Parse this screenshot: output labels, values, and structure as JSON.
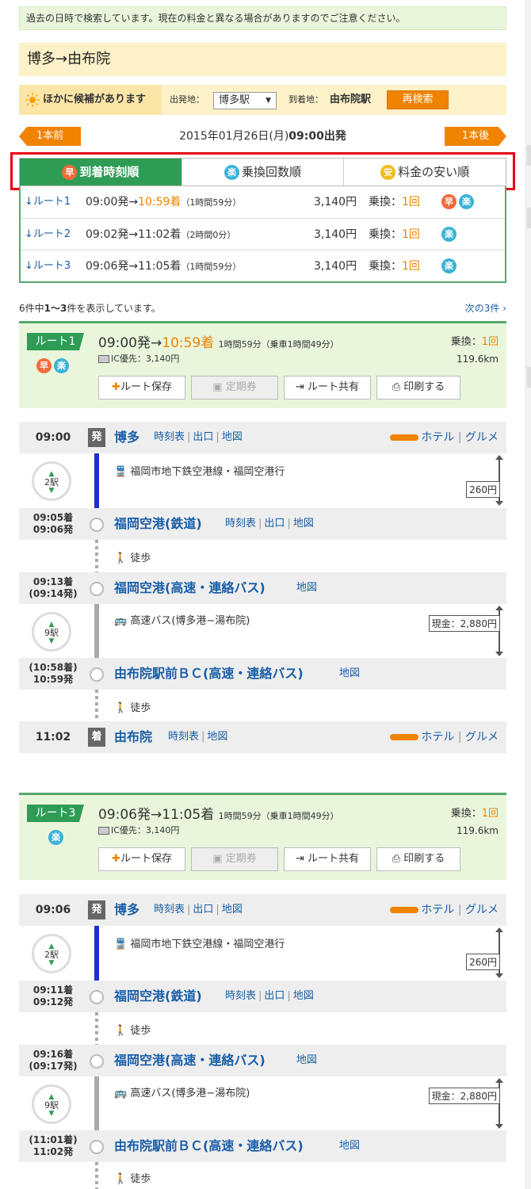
{
  "notice": "過去の日時で検索しています。現在の料金と異なる場合がありますのでご注意ください。",
  "title": "博多→由布院",
  "candidate": {
    "label": "ほかに候補があります",
    "from_label": "出発地：",
    "from_value": "博多駅",
    "to_label": "到着地：",
    "to_value": "由布院駅",
    "research": "再検索"
  },
  "nav": {
    "prev": "1本前",
    "next": "1本後",
    "date": "2015年01月26日(月)",
    "time": "09:00出発"
  },
  "tabs": [
    {
      "icon": "早",
      "label": "到着時刻順"
    },
    {
      "icon": "楽",
      "label": "乗換回数順"
    },
    {
      "icon": "安",
      "label": "料金の安い順"
    }
  ],
  "summary": [
    {
      "route": "↓ルート1",
      "dep": "09:00発→",
      "arr": "10:59着",
      "dur": "（1時間59分）",
      "price": "3,140円",
      "tr_label": "乗換：",
      "tr": "1回",
      "icons": [
        "早",
        "楽"
      ]
    },
    {
      "route": "↓ルート2",
      "dep": "09:02発→",
      "arr": "11:02着",
      "dur": "（2時間0分）",
      "price": "3,140円",
      "tr_label": "乗換：",
      "tr": "1回",
      "icons": [
        "楽"
      ]
    },
    {
      "route": "↓ルート3",
      "dep": "09:06発→",
      "arr": "11:05着",
      "dur": "（1時間59分）",
      "price": "3,140円",
      "tr_label": "乗換：",
      "tr": "1回",
      "icons": [
        "楽"
      ]
    }
  ],
  "count": {
    "pre": "6件中",
    "range": "1〜3",
    "post": "件を表示しています。",
    "next": "次の3件"
  },
  "route_buttons": {
    "save": "ルート保存",
    "pass": "定期券",
    "share": "ルート共有",
    "print": "印刷する"
  },
  "routes": [
    {
      "badge": "ルート1",
      "icons": [
        "早",
        "楽"
      ],
      "dep": "09:00発→",
      "arr": "10:59着",
      "dur": "1時間59分（乗車1時間49分）",
      "tr_label": "乗換：",
      "tr": "1回",
      "ic": "IC優先：3,140円",
      "km": "119.6km",
      "stations": [
        {
          "time": "09:00",
          "tag": "発",
          "name": "博多",
          "links": [
            "時刻表",
            "出口",
            "地図"
          ],
          "hotel": "ホテル",
          "gourmet": "グルメ"
        },
        {
          "time1": "09:05着",
          "time2": "09:06発",
          "name": "福岡空港(鉄道)",
          "links": [
            "時刻表",
            "出口",
            "地図"
          ]
        },
        {
          "time1": "09:13着",
          "time2": "(09:14発)",
          "name": "福岡空港(高速・連絡バス)",
          "links": [
            "地図"
          ]
        },
        {
          "time1": "(10:58着)",
          "time2": "10:59発",
          "name": "由布院駅前ＢＣ(高速・連絡バス)",
          "links": [
            "地図"
          ]
        },
        {
          "time": "11:02",
          "tag": "着",
          "name": "由布院",
          "links": [
            "時刻表",
            "地図"
          ],
          "hotel": "ホテル",
          "gourmet": "グルメ"
        }
      ],
      "seg1": {
        "stops": "2駅",
        "line": "福岡市地下鉄空港線・福岡空港行",
        "fare": "260円"
      },
      "walk1": "徒歩",
      "seg2": {
        "stops": "9駅",
        "line": "高速バス(博多港−湯布院)",
        "fare": "現金：2,880円"
      },
      "walk2": "徒歩"
    },
    {
      "badge": "ルート3",
      "icons": [
        "楽"
      ],
      "dep": "09:06発→",
      "arr": "11:05着",
      "dur": "1時間59分（乗車1時間49分）",
      "tr_label": "乗換：",
      "tr": "1回",
      "ic": "IC優先：3,140円",
      "km": "119.6km",
      "stations": [
        {
          "time": "09:06",
          "tag": "発",
          "name": "博多",
          "links": [
            "時刻表",
            "出口",
            "地図"
          ],
          "hotel": "ホテル",
          "gourmet": "グルメ"
        },
        {
          "time1": "09:11着",
          "time2": "09:12発",
          "name": "福岡空港(鉄道)",
          "links": [
            "時刻表",
            "出口",
            "地図"
          ]
        },
        {
          "time1": "09:16着",
          "time2": "(09:17発)",
          "name": "福岡空港(高速・連絡バス)",
          "links": [
            "地図"
          ]
        },
        {
          "time1": "(11:01着)",
          "time2": "11:02発",
          "name": "由布院駅前ＢＣ(高速・連絡バス)",
          "links": [
            "地図"
          ]
        }
      ],
      "seg1": {
        "stops": "2駅",
        "line": "福岡市地下鉄空港線・福岡空港行",
        "fare": "260円"
      },
      "walk1": "徒歩",
      "seg2": {
        "stops": "9駅",
        "line": "高速バス(博多港−湯布院)",
        "fare": "現金：2,880円"
      },
      "walk2": "徒歩"
    }
  ]
}
